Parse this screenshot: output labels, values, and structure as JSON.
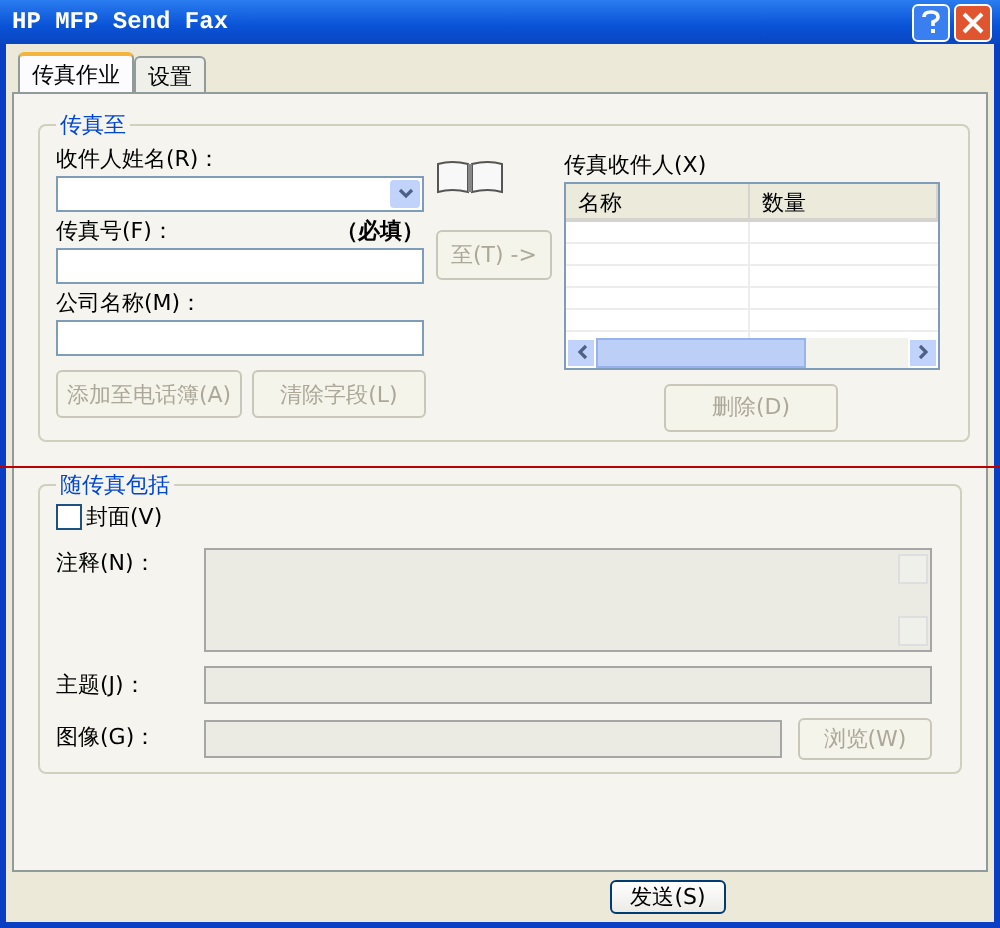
{
  "window": {
    "title": "HP MFP Send Fax"
  },
  "tabs": [
    {
      "label": "传真作业",
      "selected": true
    },
    {
      "label": "设置",
      "selected": false
    }
  ],
  "fax_to": {
    "title": "传真至",
    "recipient_name": {
      "label": "收件人姓名(R)："
    },
    "fax_number": {
      "label": "传真号(F)：",
      "required_note": "（必填）"
    },
    "company": {
      "label": "公司名称(M)："
    },
    "to_button": {
      "label": "至(T) ->",
      "disabled": true
    },
    "add_button": {
      "label": "添加至电话簿(A)",
      "disabled": true
    },
    "clear_button": {
      "label": "清除字段(L)",
      "disabled": true
    },
    "recipients": {
      "label": "传真收件人(X)",
      "columns": [
        "名称",
        "数量"
      ]
    },
    "delete_button": {
      "label": "删除(D)",
      "disabled": true
    }
  },
  "include": {
    "title": "随传真包括",
    "cover": {
      "label": "封面(V)",
      "checked": false
    },
    "notes": {
      "label": "注释(N)：",
      "disabled": true
    },
    "subject": {
      "label": "主题(J)：",
      "disabled": true
    },
    "image": {
      "label": "图像(G)：",
      "disabled": true
    },
    "browse_button": {
      "label": "浏览(W)",
      "disabled": true
    }
  },
  "send_button": {
    "label": "发送(S)",
    "disabled": false
  }
}
